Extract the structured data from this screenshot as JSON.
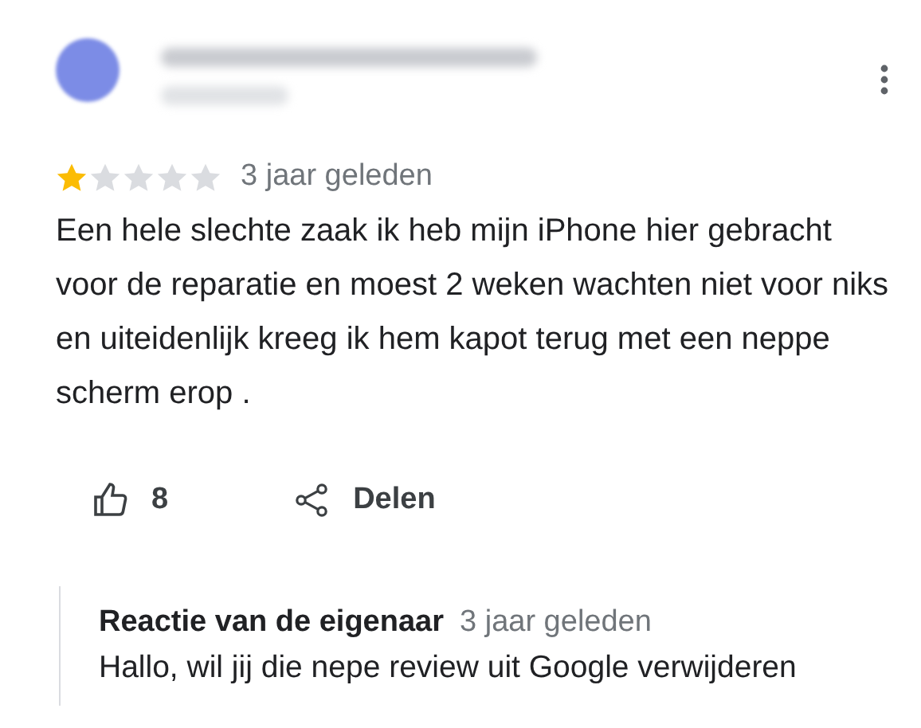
{
  "review": {
    "stars": 1,
    "time": "3 jaar geleden",
    "text": "Een hele slechte zaak ik heb mijn iPhone hier gebracht voor de reparatie en moest 2 weken wachten niet voor niks en uiteidenlijk kreeg ik hem kapot terug met een neppe scherm erop .",
    "likes": "8",
    "share_label": "Delen"
  },
  "reply": {
    "author": "Reactie van de eigenaar",
    "time": "3 jaar geleden",
    "text": "Hallo, wil jij die nepe review uit Google verwijderen"
  }
}
